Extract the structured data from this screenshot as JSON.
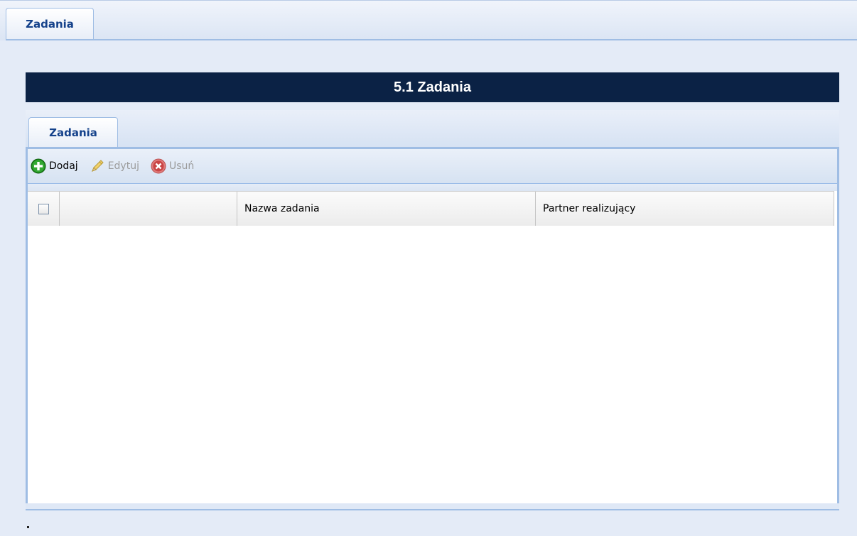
{
  "window": {
    "top_tab": "Zadania"
  },
  "heading": "5.1 Zadania",
  "panel": {
    "tab": "Zadania",
    "toolbar": {
      "add_label": "Dodaj",
      "edit_label": "Edytuj",
      "delete_label": "Usuń",
      "add_icon": "plus-circle-icon",
      "edit_icon": "pencil-icon",
      "delete_icon": "x-circle-icon"
    },
    "grid": {
      "columns": [
        "",
        "",
        "Nazwa zadania",
        "Partner realizujący"
      ],
      "rows": []
    }
  },
  "footer_mark": "."
}
